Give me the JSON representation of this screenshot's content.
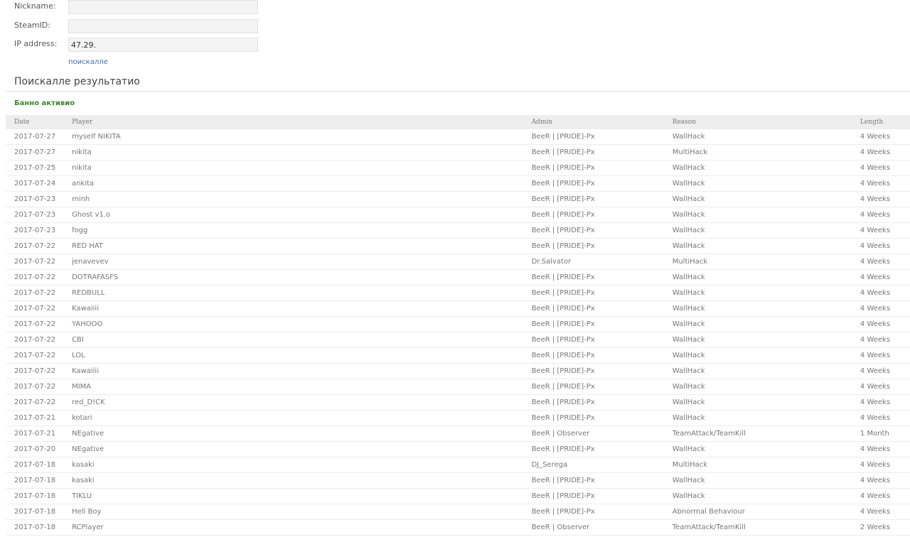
{
  "form": {
    "nickname_label": "Nickname:",
    "nickname_value": "",
    "steamid_label": "SteamID:",
    "steamid_value": "",
    "ip_label": "IP address:",
    "ip_value": "47.29.",
    "search_link": "поискалле"
  },
  "results": {
    "title": "Поискалле результатио",
    "status": "Банно активио",
    "status_color": "#3a8a2a",
    "columns": [
      "Date",
      "Player",
      "Admin",
      "Reason",
      "Length"
    ],
    "rows": [
      [
        "2017-07-27",
        "myself NIKITA",
        "BeeR | [PRIDE]-Px",
        "WallHack",
        "4 Weeks"
      ],
      [
        "2017-07-27",
        "nikita",
        "BeeR | [PRIDE]-Px",
        "MultiHack",
        "4 Weeks"
      ],
      [
        "2017-07-25",
        "nikita",
        "BeeR | [PRIDE]-Px",
        "WallHack",
        "4 Weeks"
      ],
      [
        "2017-07-24",
        "ankita",
        "BeeR | [PRIDE]-Px",
        "WallHack",
        "4 Weeks"
      ],
      [
        "2017-07-23",
        "minh",
        "BeeR | [PRIDE]-Px",
        "WallHack",
        "4 Weeks"
      ],
      [
        "2017-07-23",
        "Ghost v1.o",
        "BeeR | [PRIDE]-Px",
        "WallHack",
        "4 Weeks"
      ],
      [
        "2017-07-23",
        "fogg",
        "BeeR | [PRIDE]-Px",
        "WallHack",
        "4 Weeks"
      ],
      [
        "2017-07-22",
        "RED HAT",
        "BeeR | [PRIDE]-Px",
        "WallHack",
        "4 Weeks"
      ],
      [
        "2017-07-22",
        "jenavevev",
        "Dr.Salvator",
        "MultiHack",
        "4 Weeks"
      ],
      [
        "2017-07-22",
        "DOTRAFASFS",
        "BeeR | [PRIDE]-Px",
        "WallHack",
        "4 Weeks"
      ],
      [
        "2017-07-22",
        "REDBULL",
        "BeeR | [PRIDE]-Px",
        "WallHack",
        "4 Weeks"
      ],
      [
        "2017-07-22",
        "Kawaiiii",
        "BeeR | [PRIDE]-Px",
        "WallHack",
        "4 Weeks"
      ],
      [
        "2017-07-22",
        "YAHOOO",
        "BeeR | [PRIDE]-Px",
        "WallHack",
        "4 Weeks"
      ],
      [
        "2017-07-22",
        "CBI",
        "BeeR | [PRIDE]-Px",
        "WallHack",
        "4 Weeks"
      ],
      [
        "2017-07-22",
        "LOL",
        "BeeR | [PRIDE]-Px",
        "WallHack",
        "4 Weeks"
      ],
      [
        "2017-07-22",
        "Kawaiiii",
        "BeeR | [PRIDE]-Px",
        "WallHack",
        "4 Weeks"
      ],
      [
        "2017-07-22",
        "MIMA",
        "BeeR | [PRIDE]-Px",
        "WallHack",
        "4 Weeks"
      ],
      [
        "2017-07-22",
        "red_D!CK",
        "BeeR | [PRIDE]-Px",
        "WallHack",
        "4 Weeks"
      ],
      [
        "2017-07-21",
        "kotari",
        "BeeR | [PRIDE]-Px",
        "WallHack",
        "4 Weeks"
      ],
      [
        "2017-07-21",
        "NEgative",
        "BeeR | Observer",
        "TeamAttack/TeamKill",
        "1 Month"
      ],
      [
        "2017-07-20",
        "NEgative",
        "BeeR | [PRIDE]-Px",
        "WallHack",
        "4 Weeks"
      ],
      [
        "2017-07-18",
        "kasaki",
        "DJ_Serega",
        "MultiHack",
        "4 Weeks"
      ],
      [
        "2017-07-18",
        "kasaki",
        "BeeR | [PRIDE]-Px",
        "WallHack",
        "4 Weeks"
      ],
      [
        "2017-07-18",
        "TIKLU",
        "BeeR | [PRIDE]-Px",
        "WallHack",
        "4 Weeks"
      ],
      [
        "2017-07-18",
        "Hell Boy",
        "BeeR | [PRIDE]-Px",
        "Abnormal Behaviour",
        "4 Weeks"
      ],
      [
        "2017-07-18",
        "RCPlayer",
        "BeeR | Observer",
        "TeamAttack/TeamKill",
        "2 Weeks"
      ]
    ]
  }
}
